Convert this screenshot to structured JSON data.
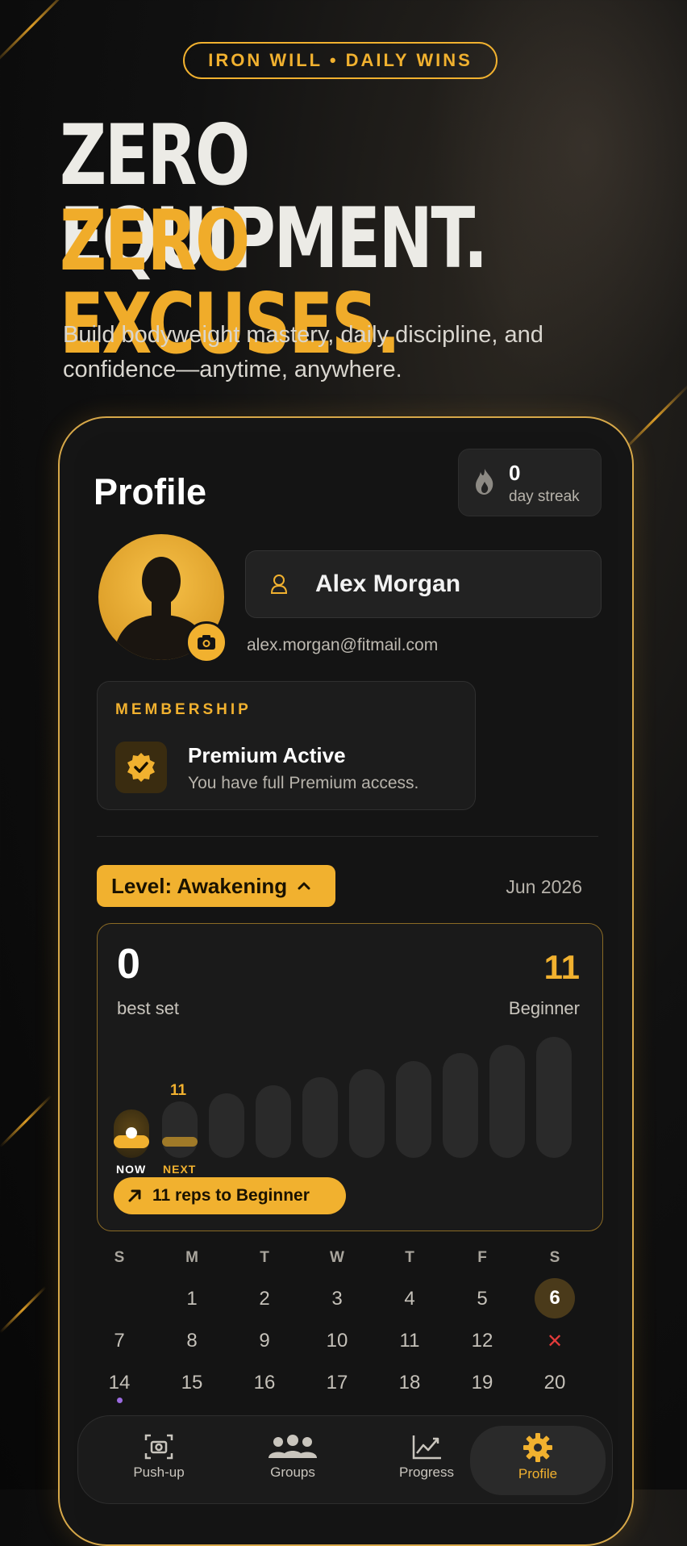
{
  "hero": {
    "pill": "IRON WILL • DAILY WINS",
    "headline_1": "ZERO EQUIPMENT.",
    "headline_2": "ZERO EXCUSES.",
    "subtitle": "Build bodyweight mastery, daily discipline, and confidence—anytime, anywhere."
  },
  "profile": {
    "title": "Profile",
    "streak": {
      "value": "0",
      "label": "day streak"
    },
    "name": "Alex Morgan",
    "email": "alex.morgan@fitmail.com"
  },
  "membership": {
    "heading": "MEMBERSHIP",
    "status": "Premium Active",
    "description": "You have full Premium access."
  },
  "level": {
    "label": "Level: Awakening",
    "date": "Jun 2026"
  },
  "progress": {
    "best_value": "0",
    "best_label": "best set",
    "target_value": "11",
    "target_label": "Beginner",
    "now_label": "NOW",
    "next_label": "NEXT",
    "next_value": "11",
    "reps_message": "11 reps to Beginner"
  },
  "calendar": {
    "weekdays": [
      "S",
      "M",
      "T",
      "W",
      "T",
      "F",
      "S"
    ],
    "week1": [
      "",
      "1",
      "2",
      "3",
      "4",
      "5",
      "6"
    ],
    "week2": [
      "7",
      "8",
      "9",
      "10",
      "11",
      "12",
      "✕"
    ],
    "week3": [
      "14",
      "15",
      "16",
      "17",
      "18",
      "19",
      "20"
    ],
    "today": "6"
  },
  "tabs": [
    {
      "label": "Push-up",
      "icon": "camera-icon"
    },
    {
      "label": "Groups",
      "icon": "groups-icon"
    },
    {
      "label": "Progress",
      "icon": "chart-icon"
    },
    {
      "label": "Profile",
      "icon": "gear-icon"
    }
  ],
  "colors": {
    "accent": "#f1b12f",
    "background": "#0b0b0b",
    "card": "#1c1c1c",
    "missed": "#e23b3b"
  }
}
